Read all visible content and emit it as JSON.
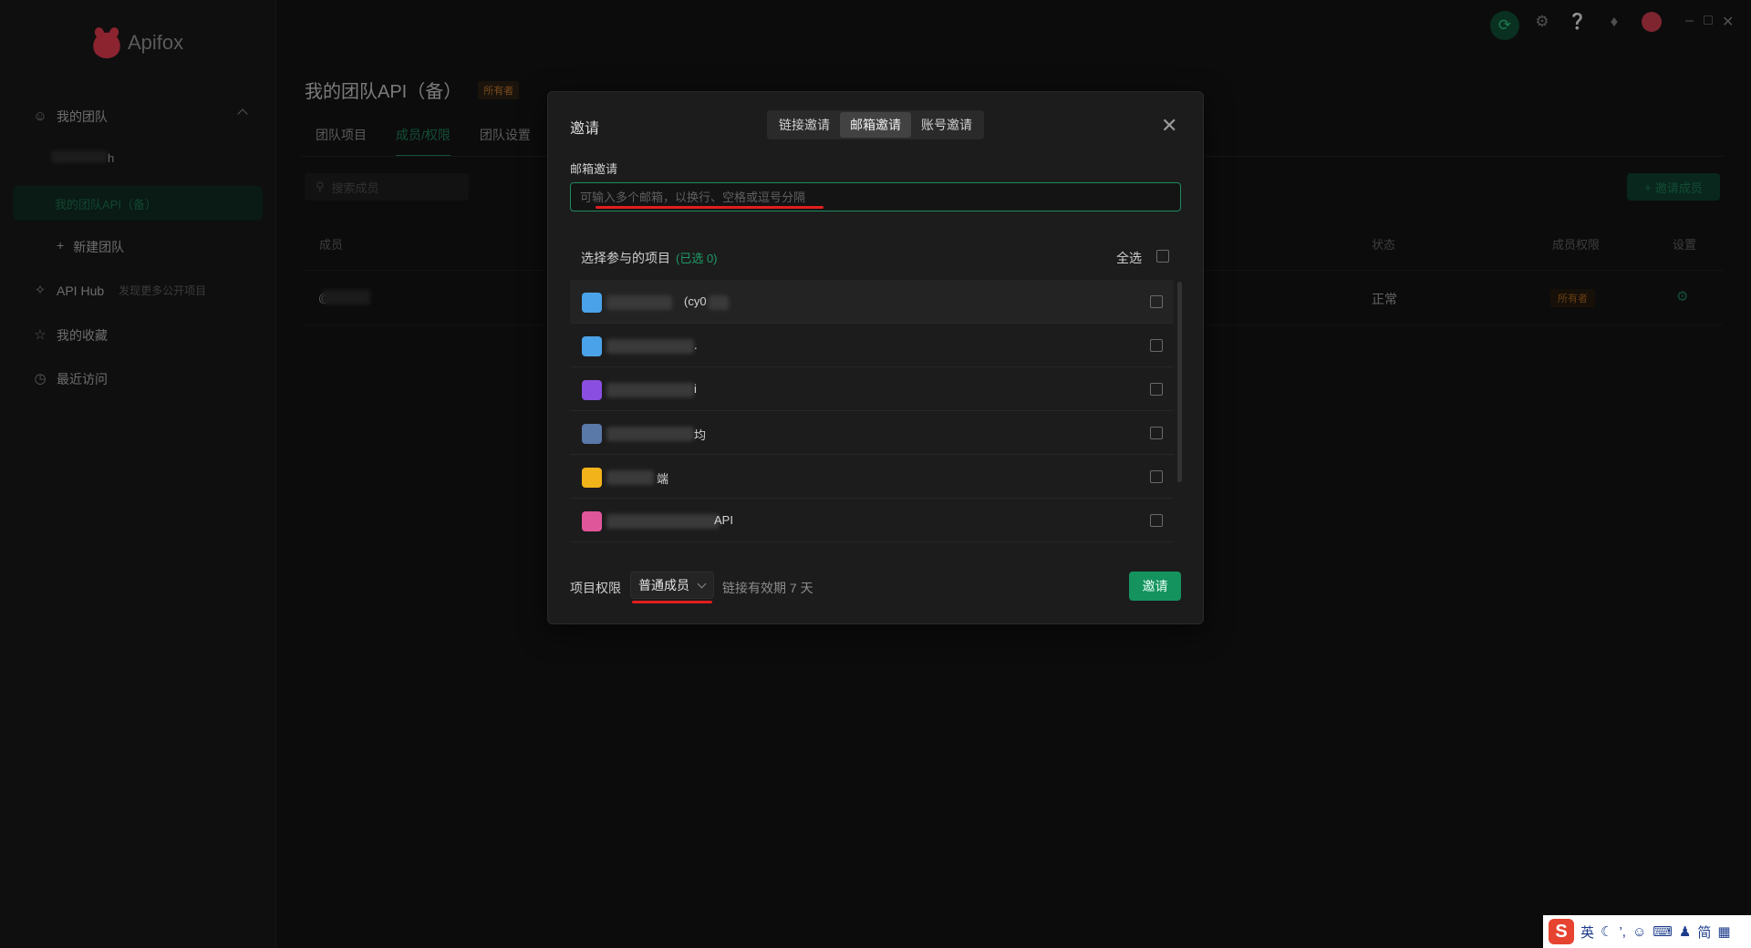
{
  "app": {
    "logo_text": "Apifox"
  },
  "sidebar": {
    "my_team": "我的团队",
    "team_name_suffix": "h",
    "active_team": "我的团队API（备）",
    "new_team": "新建团队",
    "api_hub": "API Hub",
    "api_hub_sub": "发现更多公开项目",
    "favorites": "我的收藏",
    "recent": "最近访问"
  },
  "header": {
    "title": "我的团队API（备）",
    "badge": "所有者"
  },
  "tabs": [
    {
      "label": "团队项目"
    },
    {
      "label": "成员/权限"
    },
    {
      "label": "团队设置"
    }
  ],
  "members": {
    "search_placeholder": "搜索成员",
    "invite_button": "邀请成员",
    "columns": {
      "member": "成员",
      "status": "状态",
      "role": "成员权限",
      "settings": "设置"
    },
    "row": {
      "prefix": "@",
      "status": "正常",
      "role": "所有者"
    }
  },
  "modal": {
    "title": "邀请",
    "modes": [
      "链接邀请",
      "邮箱邀请",
      "账号邀请"
    ],
    "active_mode": "邮箱邀请",
    "email_label": "邮箱邀请",
    "email_placeholder": "可输入多个邮箱，以换行、空格或逗号分隔",
    "email_value": "",
    "project_heading": "选择参与的项目",
    "selected_count": "(已选 0)",
    "select_all": "全选",
    "projects": [
      {
        "visible_text": "(cy0",
        "icon_color": "#4aa3e8"
      },
      {
        "visible_text": ".",
        "icon_color": "#4aa3e8"
      },
      {
        "visible_text": "i",
        "icon_color": "#8a4fe0"
      },
      {
        "visible_text": "均",
        "icon_color": "#5a78a8"
      },
      {
        "visible_text": "端",
        "icon_color": "#f2b21a"
      },
      {
        "visible_text": "API",
        "icon_color": "#e0569a"
      }
    ],
    "permission_label": "项目权限",
    "permission_value": "普通成员",
    "link_validity": "链接有效期 7 天",
    "submit": "邀请"
  },
  "ime": {
    "lang": "英",
    "mode": "简"
  },
  "colors": {
    "accent": "#15935f",
    "brand": "#d8384a",
    "annotation": "#e01e1e"
  }
}
